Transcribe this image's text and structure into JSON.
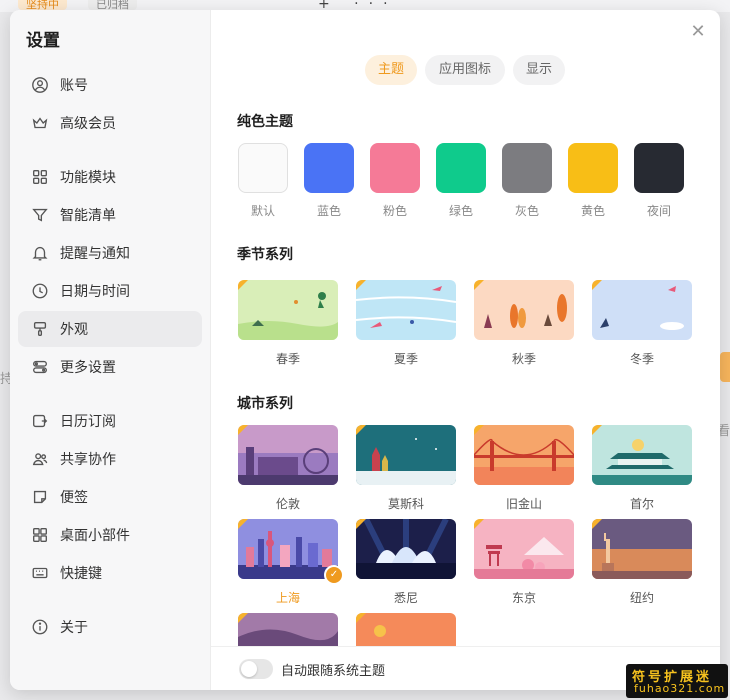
{
  "background": {
    "tab_active": "坚持中",
    "tab_archived": "已归档",
    "icons": "+ ···",
    "left_text": "持",
    "right_text": "查看"
  },
  "sidebar": {
    "title": "设置",
    "items": [
      {
        "label": "账号",
        "icon": "user-icon"
      },
      {
        "label": "高级会员",
        "icon": "crown-icon"
      },
      {
        "label": "功能模块",
        "icon": "grid-icon"
      },
      {
        "label": "智能清单",
        "icon": "filter-icon"
      },
      {
        "label": "提醒与通知",
        "icon": "bell-icon"
      },
      {
        "label": "日期与时间",
        "icon": "clock-icon"
      },
      {
        "label": "外观",
        "icon": "brush-icon",
        "active": true
      },
      {
        "label": "更多设置",
        "icon": "toggles-icon"
      },
      {
        "label": "日历订阅",
        "icon": "calendar-link-icon"
      },
      {
        "label": "共享协作",
        "icon": "users-icon"
      },
      {
        "label": "便签",
        "icon": "note-icon"
      },
      {
        "label": "桌面小部件",
        "icon": "widget-icon"
      },
      {
        "label": "快捷键",
        "icon": "keyboard-icon"
      },
      {
        "label": "关于",
        "icon": "info-icon"
      }
    ]
  },
  "main": {
    "tabs": [
      {
        "label": "主题",
        "active": true
      },
      {
        "label": "应用图标"
      },
      {
        "label": "显示"
      }
    ],
    "solid": {
      "title": "纯色主题",
      "colors": [
        {
          "label": "默认",
          "color": "#fafafa"
        },
        {
          "label": "蓝色",
          "color": "#4a73f5"
        },
        {
          "label": "粉色",
          "color": "#f57a97"
        },
        {
          "label": "绿色",
          "color": "#0fcb8c"
        },
        {
          "label": "灰色",
          "color": "#7c7c80"
        },
        {
          "label": "黄色",
          "color": "#f8be16"
        },
        {
          "label": "夜间",
          "color": "#272a32"
        }
      ]
    },
    "season": {
      "title": "季节系列",
      "items": [
        {
          "label": "春季"
        },
        {
          "label": "夏季"
        },
        {
          "label": "秋季"
        },
        {
          "label": "冬季"
        }
      ]
    },
    "city": {
      "title": "城市系列",
      "items": [
        {
          "label": "伦敦"
        },
        {
          "label": "莫斯科"
        },
        {
          "label": "旧金山"
        },
        {
          "label": "首尔"
        },
        {
          "label": "上海",
          "selected": true
        },
        {
          "label": "悉尼"
        },
        {
          "label": "东京"
        },
        {
          "label": "纽约"
        }
      ]
    },
    "footer": {
      "auto_follow_label": "自动跟随系统主题"
    }
  },
  "watermark": {
    "line1": "符号扩展迷",
    "line2": "fuhao321.com"
  },
  "accent_color": "#ef9a1f"
}
